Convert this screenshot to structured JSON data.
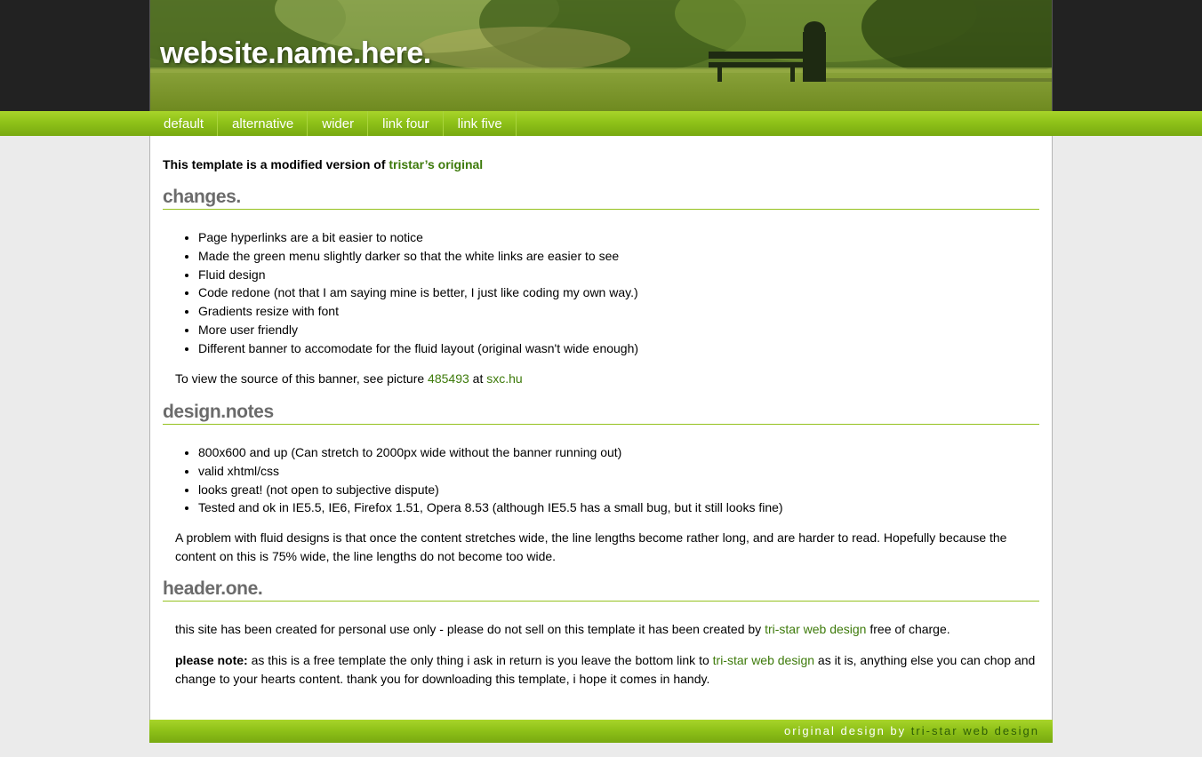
{
  "site": {
    "title": "website.name.here."
  },
  "nav": [
    "default",
    "alternative",
    "wider",
    "link four",
    "link five"
  ],
  "intro": {
    "text": "This template is a modified version of ",
    "link": "tristar’s original"
  },
  "sections": {
    "changes": {
      "heading": "changes.",
      "items": [
        "Page hyperlinks are a bit easier to notice",
        "Made the green menu slightly darker so that the white links are easier to see",
        "Fluid design",
        "Code redone (not that I am saying mine is better, I just like coding my own way.)",
        "Gradients resize with font",
        "More user friendly",
        "Different banner to accomodate for the fluid layout (original wasn't wide enough)"
      ],
      "source_text": "To view the source of this banner, see picture ",
      "source_link1": "485493",
      "source_mid": " at ",
      "source_link2": "sxc.hu"
    },
    "design": {
      "heading": "design.notes",
      "items": [
        "800x600 and up (Can stretch to 2000px wide without the banner running out)",
        "valid xhtml/css",
        "looks great! (not open to subjective dispute)",
        "Tested and ok in IE5.5, IE6, Firefox 1.51, Opera 8.53 (although IE5.5 has a small bug, but it still looks fine)"
      ],
      "paragraph": "A problem with fluid designs is that once the content stretches wide, the line lengths become rather long, and are harder to read. Hopefully because the content on this is 75% wide, the line lengths do not become too wide."
    },
    "header_one": {
      "heading": "header.one.",
      "p1_a": "this site has been created for personal use only - please do not sell on this template it has been created by ",
      "p1_link": "tri-star web design",
      "p1_b": " free of charge.",
      "p2_label": "please note:",
      "p2_a": " as this is a free template the only thing i ask in return is you leave the bottom link to ",
      "p2_link": "tri-star web design",
      "p2_b": " as it is, anything else you can chop and change to your hearts content. thank you for downloading this template, i hope it comes in handy."
    }
  },
  "footer": {
    "text": "original design by ",
    "link": "tri-star web design"
  },
  "colors": {
    "accent_green": "#8fc219",
    "link_green": "#3d7a0a",
    "heading_gray": "#6b6b6b",
    "dark_band": "#222222"
  }
}
